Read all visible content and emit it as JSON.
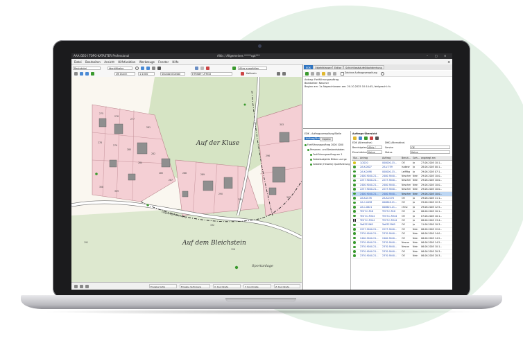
{
  "window": {
    "app_title": "AAA GEO I TOPO-KATASTER Professional",
    "doc_title": "Alkis / Allgemeines *****opt***",
    "controls": [
      "–",
      "□",
      "✕"
    ]
  },
  "menu": [
    "Datei",
    "Bearbeiten",
    "Ansicht",
    "Hilfsfunktion",
    "Werkzeuge",
    "Fenster",
    "Hilfe"
  ],
  "toolbar1": {
    "layer_select": "Basisdatei",
    "object_select": "Identifikator",
    "layer_highlight": "Alles auswählen"
  },
  "toolbar2": {
    "scale_select": "UK Durch",
    "zoom_select": "1:1000",
    "detail_select": "Standard Detail",
    "coord_select": "ETRS89_UTM32",
    "search_label": "Kathrein"
  },
  "map": {
    "labels": {
      "kluse": "Auf der Kluse",
      "bleichstein": "Auf dem Bleichstein",
      "sportanlage": "Sportanlage",
      "street": "Hugoweg/Pastorsweg"
    },
    "parcels": [
      "275",
      "276",
      "277",
      "278",
      "279",
      "280",
      "281",
      "282",
      "284",
      "285",
      "287",
      "288",
      "289",
      "290",
      "295",
      "296",
      "303",
      "305",
      "308",
      "309",
      "310",
      "311",
      "312",
      "313",
      "314",
      "315",
      "316",
      "317",
      "318",
      "319",
      "320",
      "321",
      "322",
      "338",
      "339",
      "340",
      "341",
      "342",
      "343",
      "380",
      "381",
      "382",
      "383",
      "384",
      "385",
      "386",
      "387",
      "388",
      "389",
      "192",
      "193",
      "126",
      "191",
      "180",
      "152",
      "173",
      "127",
      "124"
    ]
  },
  "statusbar": [
    "Eingabe fertig",
    "Eingabe Verfolgung",
    "X: Koordinate",
    "Y: Koordinate",
    "Z: Koordinate"
  ],
  "right_panel": {
    "tabs": [
      "EDK",
      "Objektklassen",
      "Editor",
      "Schichtlaststufe/Nachdrehung"
    ],
    "checkbox_label": "Zeichne Auftragsverwaltung",
    "info_lines": [
      "Antrag: Fortführungsauftrag",
      "Bearbeiter: Nescher",
      "Beginn am: 1x Abgeschlossen am: 20.10.2025 10:14:45, fehlgeschl: fu"
    ],
    "tree": {
      "title": "EDK - Auftragsverwaltung/Stelle",
      "tabs": [
        "Auftrag/Stelle",
        "Objekte"
      ],
      "items": [
        "Fortführungsauftrag 2000 1000",
        "Personen- und Bestandsdaten",
        "Fortführungsauftrag am 1",
        "Gebietsobjekte Bilden und ge",
        "Gebiete (Hinweis) Qualifizierung"
      ]
    },
    "orders": {
      "title": "Auftrags-Übersicht",
      "edk_label": "EDK (Alternative)",
      "dkk_label": "DKK (Alternative)",
      "district_label": "Bereinigstand",
      "district_value": "Alkis /",
      "service_label": "Service",
      "service_value": "OE",
      "restriction_label": "Einschränkung",
      "restriction_value": "Keine",
      "status_label": "Status",
      "status_value": "Keine",
      "columns": [
        "Sta...",
        "Antrag",
        "Auftrag",
        "Benut...",
        "Geh...",
        "angelegt am"
      ],
      "rows": [
        [
          "1/2020",
          "000000-15...",
          "OE",
          "Ja",
          "27.06.2005 10:1..."
        ],
        [
          "2A-K-0827",
          "2A-V-7E9",
          "Isabew",
          "Ja",
          "28.06.2005 00:1..."
        ],
        [
          "2A-K-0498",
          "000000-15...",
          "Leiflfkg",
          "Ja",
          "29.06.2005 07:1..."
        ],
        [
          "2400-9040-21...",
          "2400-9040...",
          "Nescher",
          "Nein",
          "29.06.2005 10:0..."
        ],
        [
          "2237-9040-21...",
          "2237-9040...",
          "Nescher",
          "Nein",
          "29.06.2005 10:0..."
        ],
        [
          "2400-9040-21...",
          "2400-9040...",
          "Nescher",
          "Nein",
          "29.06.2005 10:0..."
        ],
        [
          "2237-9040-21...",
          "2237-9040...",
          "Nescher",
          "Nein",
          "29.06.2005 10:0..."
        ],
        [
          "2400-9040-21...",
          "2400-9040...",
          "Nescher",
          "Nein",
          "29.06.2005 10:0..."
        ],
        [
          "2A-K-0176",
          "2A-K-0176",
          "OE",
          "Ja",
          "29.06.2005 11:1..."
        ],
        [
          "2A-C-0498",
          "000848-21...",
          "OE",
          "Ja",
          "29.06.2005 12:3..."
        ],
        [
          "2A-C-0621",
          "000601-21...",
          "chrsc",
          "Ja",
          "29.06.2005 12:5..."
        ],
        [
          "TEST-C-R18",
          "TEST-C-R18",
          "OE",
          "Ja",
          "06.06.2005 10:1..."
        ],
        [
          "TEST-C-R344",
          "TEST-C-R344",
          "OE",
          "Ja",
          "07.06.2005 10:1..."
        ],
        [
          "TEST-C-R344",
          "TEST-C-R344",
          "OE",
          "Ja",
          "08.06.2005 13:4..."
        ],
        [
          "5b6323965",
          "5b6323965",
          "OE",
          "Ja",
          "11.06.2005 10:3..."
        ],
        [
          "2237-9040-21...",
          "2237-9040...",
          "OE",
          "Nein",
          "06.06.2005 12:0..."
        ],
        [
          "2370-9040-21...",
          "2370-9040...",
          "OE",
          "Nein",
          "06.06.2005 14:0..."
        ],
        [
          "2400-9040-21...",
          "2400-9040...",
          "OE",
          "Nein",
          "06.06.2005 14:2..."
        ],
        [
          "2370-9040-21...",
          "2370-9040...",
          "Nescar",
          "Nein",
          "06.06.2005 14:2..."
        ],
        [
          "2370-9040-21...",
          "2370-9040...",
          "Nescar",
          "Nein",
          "06.06.2005 10:1..."
        ],
        [
          "2370-9040-21...",
          "2370-9040...",
          "OE",
          "Nein",
          "06.06.2005 20:3..."
        ],
        [
          "2370-9040-21...",
          "2370-9040...",
          "OE",
          "Nein",
          "06.06.2005 20:3..."
        ]
      ],
      "row_states": [
        "yellow",
        "green",
        "green",
        "green",
        "green",
        "green",
        "green",
        "green",
        "green",
        "green",
        "green",
        "green",
        "green",
        "pause",
        "green",
        "green",
        "green",
        "green",
        "green",
        "green",
        "green",
        "green"
      ],
      "highlighted_row": 7
    }
  },
  "colors": {
    "accent": "#2f74c0",
    "background_blob": "#e4f1e6",
    "parcel_pink": "#f4cfd4",
    "map_green": "#d6e4c4",
    "status_green": "#3a9a2e",
    "status_yellow": "#d8c41e"
  }
}
